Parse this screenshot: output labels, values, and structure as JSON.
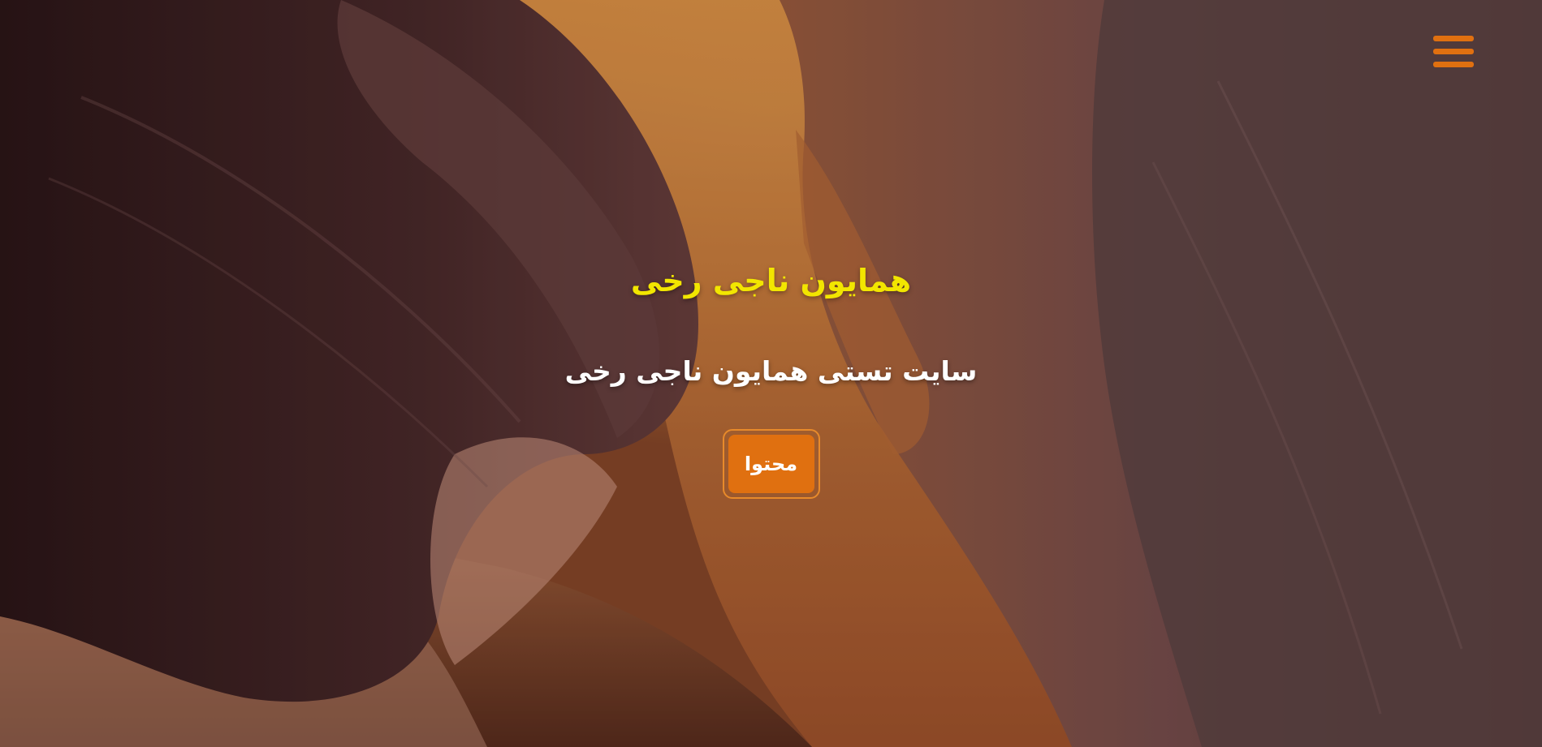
{
  "colors": {
    "accent": "#e07010",
    "title": "#f2e600",
    "subtitle": "#ffffff",
    "button_border": "#e88a2a"
  },
  "header": {
    "menu_icon": "hamburger-menu-icon"
  },
  "hero": {
    "title": "همایون ناجی رخی",
    "subtitle": "سایت تستی همایون ناجی رخی",
    "button_label": "محتوا"
  }
}
